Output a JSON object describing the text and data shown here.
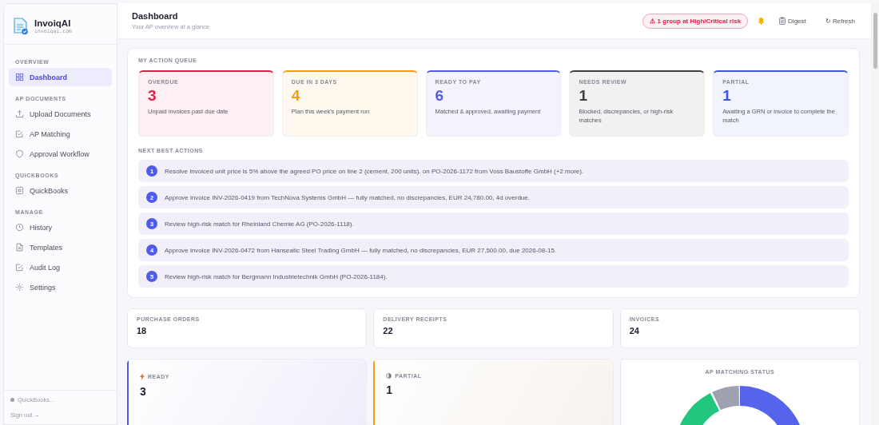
{
  "brand": {
    "name": "InvoiqAI",
    "domain": "invoiqai.com"
  },
  "sidebar": {
    "sections": [
      {
        "title": "OVERVIEW",
        "items": [
          {
            "label": "Dashboard",
            "selected": true
          }
        ]
      },
      {
        "title": "AP DOCUMENTS",
        "items": [
          {
            "label": "Upload Documents",
            "selected": false
          },
          {
            "label": "AP Matching",
            "selected": false
          },
          {
            "label": "Approval Workflow",
            "selected": false
          }
        ]
      },
      {
        "title": "QUICKBOOKS",
        "items": [
          {
            "label": "QuickBooks",
            "selected": false
          }
        ]
      },
      {
        "title": "MANAGE",
        "items": [
          {
            "label": "History",
            "selected": false
          },
          {
            "label": "Templates",
            "selected": false
          },
          {
            "label": "Audit Log",
            "selected": false
          },
          {
            "label": "Settings",
            "selected": false
          }
        ]
      }
    ],
    "status": "QuickBooks...",
    "sign_out": "Sign out →"
  },
  "header": {
    "title": "Dashboard",
    "subtitle": "Your AP overview at a glance",
    "risk_badge": "⚠ 1 group at High/Critical risk",
    "digest": "Digest",
    "refresh": "↻ Refresh"
  },
  "action_queue": {
    "title": "MY ACTION QUEUE",
    "cards": [
      {
        "label": "OVERDUE",
        "count": "3",
        "text": "Unpaid invoices past due date",
        "color": "#e11d48"
      },
      {
        "label": "DUE IN 3 DAYS",
        "count": "4",
        "text": "Plan this week's payment run",
        "color": "#f59e0b"
      },
      {
        "label": "READY TO PAY",
        "count": "6",
        "text": "Matched & approved, awaiting payment",
        "color": "#4f5bea"
      },
      {
        "label": "NEEDS REVIEW",
        "count": "1",
        "text": "Blocked, discrepancies, or high-risk matches",
        "color": "#3f3f46"
      },
      {
        "label": "PARTIAL",
        "count": "1",
        "text": "Awaiting a GRN or invoice to complete the match",
        "color": "#3b55e6"
      }
    ]
  },
  "next_actions": {
    "title": "NEXT BEST ACTIONS",
    "items": [
      {
        "number": "1",
        "text": "Resolve Invoiced unit price is 5% above the agreed PO price on line 2 (cement, 200 units). on PO-2026-1172 from Voss Baustoffe GmbH (+2 more)."
      },
      {
        "number": "2",
        "text": "Approve invoice INV-2026-0419 from TechNova Systems GmbH — fully matched, no discrepancies, EUR 24,780.00, 4d overdue."
      },
      {
        "number": "3",
        "text": "Review high-risk match for Rheinland Chemie AG (PO-2026-1118)."
      },
      {
        "number": "4",
        "text": "Approve invoice INV-2026-0472 from Hanseatic Steel Trading GmbH — fully matched, no discrepancies, EUR 27,500.00, due 2026-08-15."
      },
      {
        "number": "5",
        "text": "Review high-risk match for Bergmann Industrietechnik GmbH (PO-2026-1184)."
      }
    ]
  },
  "stats": [
    {
      "label": "PURCHASE ORDERS",
      "value": "18"
    },
    {
      "label": "DELIVERY RECEIPTS",
      "value": "22"
    },
    {
      "label": "INVOICES",
      "value": "24"
    }
  ],
  "status_cards": [
    {
      "label": "READY",
      "value": "3",
      "color": "#4f5bea"
    },
    {
      "label": "PARTIAL",
      "value": "1",
      "color": "#f59e0b"
    }
  ],
  "matching_chart": {
    "title": "AP MATCHING STATUS"
  }
}
